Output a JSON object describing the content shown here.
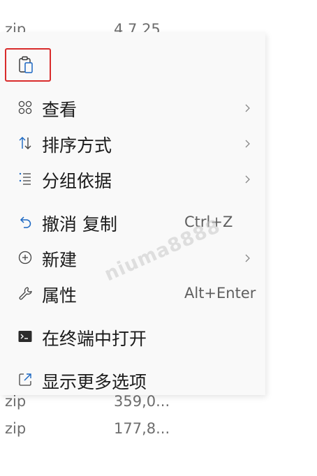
{
  "background_files": {
    "top_row": {
      "ext": "zip",
      "size": "4,7.25..."
    },
    "rows": [
      {
        "ext": "zip",
        "size": "359,0..."
      },
      {
        "ext": "zip",
        "size": "177,8..."
      }
    ]
  },
  "context_menu": {
    "toolbar": {
      "paste_icon": "paste-clipboard-icon"
    },
    "items": [
      {
        "label": "查看",
        "icon": "view-grid-icon",
        "submenu": true
      },
      {
        "label": "排序方式",
        "icon": "sort-arrows-icon",
        "submenu": true
      },
      {
        "label": "分组依据",
        "icon": "group-list-icon",
        "submenu": true
      },
      {
        "label": "撤消 复制",
        "icon": "undo-icon",
        "shortcut": "Ctrl+Z"
      },
      {
        "label": "新建",
        "icon": "new-plus-icon",
        "submenu": true
      },
      {
        "label": "属性",
        "icon": "wrench-icon",
        "shortcut": "Alt+Enter"
      },
      {
        "label": "在终端中打开",
        "icon": "terminal-icon"
      },
      {
        "label": "显示更多选项",
        "icon": "share-external-icon"
      }
    ]
  },
  "watermark": "niuma8888",
  "colors": {
    "highlight_border": "#d92b2b",
    "icon_blue": "#1a66c2",
    "menu_bg": "#f9f9f9"
  }
}
